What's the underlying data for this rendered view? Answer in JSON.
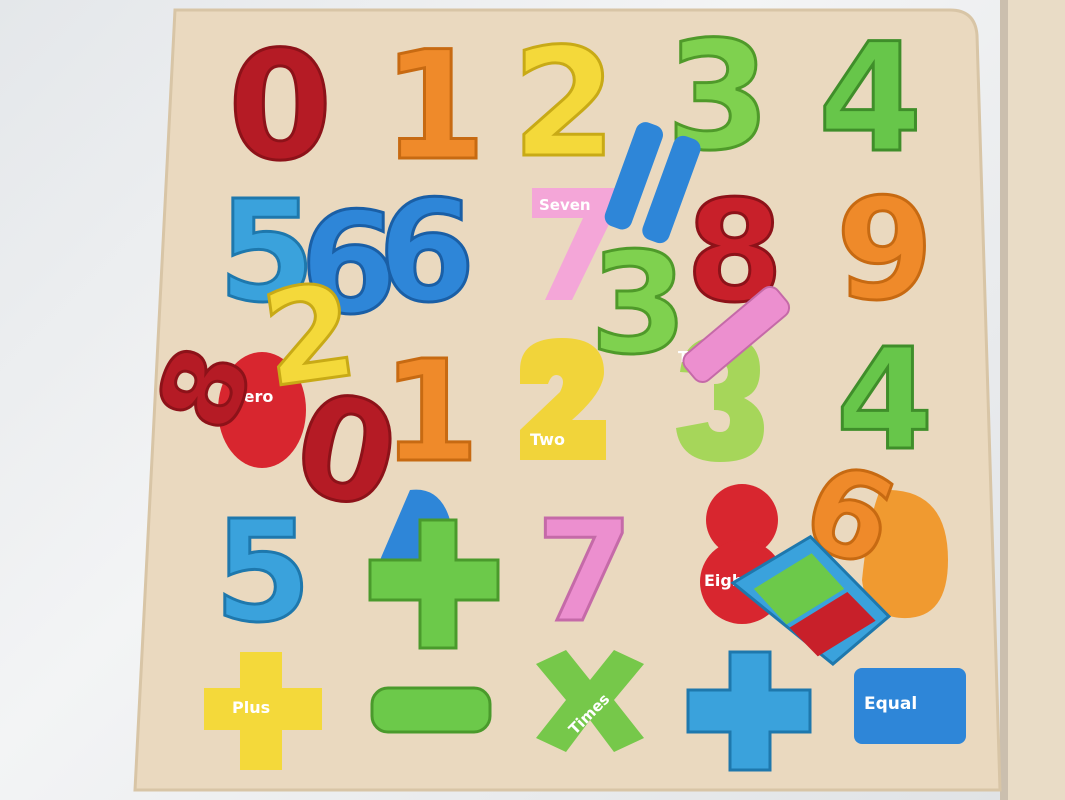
{
  "labels": {
    "zero": "Zero",
    "two": "Two",
    "three": "Three",
    "seven": "Seven",
    "eight": "Eight",
    "plus": "Plus",
    "times": "Times",
    "equal": "Equal"
  },
  "pieces": {
    "p0": "0",
    "p1": "1",
    "p2": "2",
    "p3": "3",
    "p4": "4",
    "p5": "5",
    "p6": "6",
    "p7": "7",
    "p8": "8",
    "p9": "9",
    "plus_sign": "+",
    "minus_sign": "−",
    "times_sign": "×",
    "equal_sign": "="
  },
  "colors": {
    "red": "#c8202a",
    "orange": "#ef8a2a",
    "yellow": "#f4d93a",
    "green": "#6cc94a",
    "blue": "#2e86d8",
    "light_blue": "#3aa2dc",
    "pink": "#ec8fcf",
    "board": "#ecdcc4"
  }
}
